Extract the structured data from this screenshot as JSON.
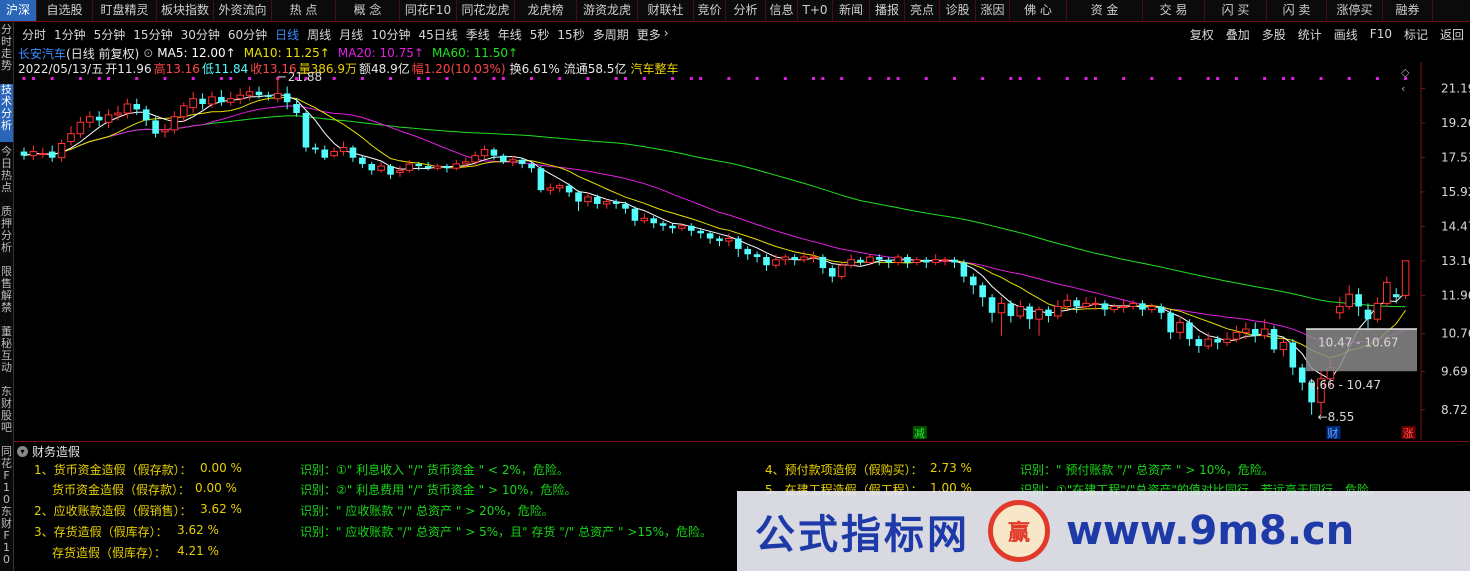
{
  "top_tabs": [
    "沪深",
    "自选股",
    "盯盘精灵",
    "板块指数",
    "外资流向",
    "热 点",
    "概 念",
    "同花F10",
    "同花龙虎",
    "龙虎榜",
    "游资龙虎",
    "财联社",
    "竞价",
    "分析",
    "信息",
    "T+0",
    "新闻",
    "播报",
    "亮点",
    "诊股",
    "涨因",
    "佛 心",
    "资 金",
    "交 易",
    "闪 买",
    "闪 卖",
    "涨停买",
    "融券"
  ],
  "left_tabs": [
    "分时走势",
    "技术分析",
    "今日热点",
    "质押分析",
    "限售解禁",
    "董秘互动",
    "东财股吧",
    "同花F10",
    "东财F10"
  ],
  "periods": [
    "分时",
    "1分钟",
    "5分钟",
    "15分钟",
    "30分钟",
    "60分钟",
    "日线",
    "周线",
    "月线",
    "10分钟",
    "45日线",
    "季线",
    "年线",
    "5秒",
    "15秒",
    "多周期",
    "更多"
  ],
  "active_period": "日线",
  "right_tools": [
    "复权",
    "叠加",
    "多股",
    "统计",
    "画线",
    "F10",
    "标记",
    "返回"
  ],
  "stock": {
    "name": "长安汽车",
    "mode": "(日线 前复权)",
    "ma": [
      {
        "label": "MA5: 12.00",
        "color": "#ffffff"
      },
      {
        "label": "MA10: 11.25",
        "color": "#e8e000"
      },
      {
        "label": "MA20: 10.75",
        "color": "#e020e0"
      },
      {
        "label": "MA60: 11.50",
        "color": "#20e020"
      }
    ],
    "date": "2022/05/13/五",
    "open": "开11.96",
    "high": "高13.16",
    "low": "低11.84",
    "close": "收13.16",
    "vol": "量386.9万",
    "amt": "额48.9亿",
    "chg": "幅1.20(10.03%)",
    "turn": "换6.61%",
    "float": "流通58.5亿",
    "sector": "汽车整车"
  },
  "y_axis": [
    "21.19",
    "19.26",
    "17.51",
    "15.92",
    "14.47",
    "13.16",
    "11.96",
    "10.76",
    "9.69",
    "8.72"
  ],
  "annotations": {
    "high": "21.88",
    "low": "8.55",
    "box1": "10.47 - 10.67",
    "box2": "9.66 - 10.47",
    "jian": "减",
    "cai": "财",
    "zhang": "涨"
  },
  "fin_title": "财务造假",
  "fin_rows": [
    {
      "label": "1、货币资金造假（假存款）：",
      "value": "0.00 %",
      "note": "识别：①\" 利息收入 \"/\" 货币资金 \" < 2%，危险。"
    },
    {
      "label": "货币资金造假（假存款）：",
      "value": "0.00 %",
      "note": "识别：②\" 利息费用 \"/\" 货币资金 \" > 10%，危险。"
    },
    {
      "label": "2、应收账款造假（假销售）：",
      "value": "3.62 %",
      "note": "识别：\" 应收账款 \"/\" 总资产 \" > 20%，危险。"
    },
    {
      "label": "3、存货造假（假库存）：",
      "value": "3.62 %",
      "note": "识别：\" 应收账款 \"/\" 总资产 \" > 5%，且\" 存货 \"/\" 总资产 \" >15%，危险。"
    },
    {
      "label": "存货造假（假库存）：",
      "value": "4.21 %",
      "note": ""
    }
  ],
  "fin_rows_right": [
    {
      "label": "4、预付款项造假（假购买）：",
      "value": "2.73 %",
      "note": "识别：\" 预付账款 \"/\" 总资产 \" > 10%，危险。"
    },
    {
      "label": "5、在建工程造假（假工程）：",
      "value": "1.00 %",
      "note": "识别：①\"在建工程\"/\"总资产\"的值对比同行，若远高于同行，危险。"
    }
  ],
  "watermark": {
    "text1": "公式指标网",
    "text2": "www.9m8.cn"
  },
  "colors": {
    "up": "#ff3232",
    "down": "#54fcfc",
    "ma5": "#ffffff",
    "ma10": "#e8e000",
    "ma20": "#e020e0",
    "ma60": "#20e020"
  },
  "chart_data": {
    "type": "candlestick",
    "ylim": [
      8.2,
      22.3
    ],
    "candles": [
      [
        17.8,
        17.6,
        18.0,
        17.4
      ],
      [
        17.6,
        17.8,
        18.1,
        17.4
      ],
      [
        17.7,
        17.7,
        18.0,
        17.5
      ],
      [
        17.8,
        17.5,
        18.1,
        17.3
      ],
      [
        17.5,
        18.2,
        18.4,
        17.3
      ],
      [
        18.3,
        18.7,
        19.1,
        18.1
      ],
      [
        18.7,
        19.3,
        19.6,
        18.5
      ],
      [
        19.3,
        19.6,
        19.9,
        19.0
      ],
      [
        19.6,
        19.4,
        19.9,
        19.1
      ],
      [
        19.3,
        19.7,
        20.0,
        19.0
      ],
      [
        19.7,
        19.8,
        20.2,
        19.4
      ],
      [
        19.8,
        20.3,
        20.6,
        19.5
      ],
      [
        20.3,
        20.0,
        20.6,
        19.7
      ],
      [
        20.0,
        19.4,
        20.2,
        19.1
      ],
      [
        19.4,
        18.7,
        19.6,
        18.5
      ],
      [
        18.8,
        18.9,
        19.2,
        18.5
      ],
      [
        18.9,
        19.6,
        19.9,
        18.7
      ],
      [
        19.6,
        20.2,
        20.4,
        19.3
      ],
      [
        20.1,
        20.6,
        21.0,
        19.8
      ],
      [
        20.6,
        20.3,
        20.9,
        20.0
      ],
      [
        20.3,
        20.7,
        21.0,
        20.1
      ],
      [
        20.7,
        20.4,
        21.1,
        20.2
      ],
      [
        20.4,
        20.6,
        21.0,
        20.2
      ],
      [
        20.6,
        20.8,
        21.2,
        20.3
      ],
      [
        20.8,
        21.0,
        21.3,
        20.5
      ],
      [
        21.0,
        20.8,
        21.3,
        20.6
      ],
      [
        20.8,
        20.7,
        21.0,
        20.5
      ],
      [
        20.6,
        20.9,
        21.9,
        20.4
      ],
      [
        20.9,
        20.4,
        21.3,
        20.0
      ],
      [
        20.3,
        19.8,
        20.6,
        19.6
      ],
      [
        19.8,
        18.0,
        19.9,
        17.8
      ],
      [
        18.0,
        17.9,
        18.2,
        17.7
      ],
      [
        17.9,
        17.5,
        18.1,
        17.4
      ],
      [
        17.6,
        17.8,
        18.0,
        17.5
      ],
      [
        17.8,
        18.0,
        18.3,
        17.6
      ],
      [
        18.0,
        17.5,
        18.1,
        17.3
      ],
      [
        17.5,
        17.2,
        17.6,
        17.0
      ],
      [
        17.2,
        16.9,
        17.3,
        16.7
      ],
      [
        16.9,
        17.1,
        17.3,
        16.8
      ],
      [
        17.1,
        16.7,
        17.2,
        16.5
      ],
      [
        16.8,
        16.9,
        17.1,
        16.6
      ],
      [
        16.9,
        17.2,
        17.4,
        16.8
      ],
      [
        17.2,
        17.1,
        17.3,
        16.9
      ],
      [
        17.1,
        17.0,
        17.3,
        16.9
      ],
      [
        17.0,
        17.1,
        17.2,
        16.9
      ],
      [
        17.1,
        17.0,
        17.2,
        16.8
      ],
      [
        17.0,
        17.2,
        17.4,
        16.9
      ],
      [
        17.2,
        17.3,
        17.5,
        17.0
      ],
      [
        17.3,
        17.6,
        17.8,
        17.1
      ],
      [
        17.6,
        17.9,
        18.1,
        17.4
      ],
      [
        17.9,
        17.6,
        18.0,
        17.4
      ],
      [
        17.6,
        17.3,
        17.7,
        17.2
      ],
      [
        17.3,
        17.4,
        17.6,
        17.1
      ],
      [
        17.4,
        17.2,
        17.5,
        17.0
      ],
      [
        17.2,
        17.0,
        17.3,
        16.8
      ],
      [
        17.0,
        16.0,
        17.1,
        15.9
      ],
      [
        16.0,
        16.1,
        16.3,
        15.8
      ],
      [
        16.1,
        16.2,
        16.3,
        15.9
      ],
      [
        16.2,
        15.9,
        16.3,
        15.7
      ],
      [
        15.9,
        15.5,
        16.0,
        15.1
      ],
      [
        15.5,
        15.7,
        15.9,
        15.3
      ],
      [
        15.7,
        15.4,
        15.8,
        15.2
      ],
      [
        15.4,
        15.5,
        15.6,
        15.2
      ],
      [
        15.5,
        15.4,
        15.6,
        15.2
      ],
      [
        15.4,
        15.2,
        15.5,
        15.0
      ],
      [
        15.2,
        14.7,
        15.3,
        14.5
      ],
      [
        14.7,
        14.8,
        15.0,
        14.6
      ],
      [
        14.8,
        14.6,
        14.9,
        14.4
      ],
      [
        14.6,
        14.5,
        14.7,
        14.3
      ],
      [
        14.5,
        14.4,
        14.6,
        14.2
      ],
      [
        14.4,
        14.5,
        14.6,
        14.3
      ],
      [
        14.5,
        14.3,
        14.6,
        14.1
      ],
      [
        14.3,
        14.2,
        14.4,
        14.0
      ],
      [
        14.2,
        14.0,
        14.3,
        13.8
      ],
      [
        14.0,
        13.9,
        14.1,
        13.7
      ],
      [
        13.9,
        14.0,
        14.2,
        13.7
      ],
      [
        14.0,
        13.6,
        14.1,
        13.3
      ],
      [
        13.6,
        13.4,
        13.7,
        13.2
      ],
      [
        13.4,
        13.3,
        13.5,
        13.1
      ],
      [
        13.3,
        13.0,
        13.4,
        12.8
      ],
      [
        13.0,
        13.2,
        13.4,
        12.9
      ],
      [
        13.2,
        13.3,
        13.4,
        13.0
      ],
      [
        13.3,
        13.2,
        13.4,
        13.0
      ],
      [
        13.2,
        13.3,
        13.5,
        13.1
      ],
      [
        13.3,
        13.3,
        13.5,
        13.1
      ],
      [
        13.3,
        12.9,
        13.4,
        12.7
      ],
      [
        12.9,
        12.6,
        13.0,
        12.4
      ],
      [
        12.6,
        13.0,
        13.1,
        12.5
      ],
      [
        13.0,
        13.2,
        13.4,
        12.9
      ],
      [
        13.2,
        13.1,
        13.3,
        13.0
      ],
      [
        13.1,
        13.3,
        13.4,
        13.0
      ],
      [
        13.3,
        13.2,
        13.4,
        13.0
      ],
      [
        13.2,
        13.1,
        13.3,
        12.9
      ],
      [
        13.1,
        13.3,
        13.4,
        13.0
      ],
      [
        13.3,
        13.1,
        13.4,
        12.9
      ],
      [
        13.1,
        13.2,
        13.3,
        13.0
      ],
      [
        13.2,
        13.1,
        13.3,
        12.9
      ],
      [
        13.1,
        13.2,
        13.4,
        13.0
      ],
      [
        13.2,
        13.2,
        13.3,
        13.0
      ],
      [
        13.2,
        13.1,
        13.3,
        12.9
      ],
      [
        13.1,
        12.6,
        13.2,
        12.4
      ],
      [
        12.6,
        12.3,
        12.7,
        12.0
      ],
      [
        12.3,
        11.9,
        12.4,
        11.6
      ],
      [
        11.9,
        11.4,
        12.0,
        11.1
      ],
      [
        11.4,
        11.7,
        11.9,
        10.7
      ],
      [
        11.7,
        11.3,
        11.8,
        11.1
      ],
      [
        11.3,
        11.6,
        11.8,
        11.2
      ],
      [
        11.6,
        11.2,
        11.7,
        10.9
      ],
      [
        11.2,
        11.5,
        11.6,
        10.7
      ],
      [
        11.5,
        11.3,
        11.6,
        11.1
      ],
      [
        11.3,
        11.6,
        11.8,
        11.2
      ],
      [
        11.6,
        11.8,
        12.0,
        11.5
      ],
      [
        11.8,
        11.6,
        11.9,
        11.4
      ],
      [
        11.6,
        11.7,
        11.9,
        11.5
      ],
      [
        11.7,
        11.7,
        11.9,
        11.5
      ],
      [
        11.7,
        11.5,
        11.8,
        11.3
      ],
      [
        11.5,
        11.6,
        11.7,
        11.4
      ],
      [
        11.6,
        11.6,
        11.8,
        11.4
      ],
      [
        11.6,
        11.7,
        11.8,
        11.5
      ],
      [
        11.7,
        11.5,
        11.8,
        11.3
      ],
      [
        11.5,
        11.6,
        11.7,
        11.4
      ],
      [
        11.6,
        11.4,
        11.7,
        11.2
      ],
      [
        11.4,
        10.8,
        11.5,
        10.6
      ],
      [
        10.8,
        11.1,
        11.3,
        10.6
      ],
      [
        11.1,
        10.6,
        11.2,
        10.4
      ],
      [
        10.6,
        10.4,
        10.7,
        10.2
      ],
      [
        10.4,
        10.6,
        10.8,
        10.3
      ],
      [
        10.6,
        10.5,
        10.7,
        10.3
      ],
      [
        10.5,
        10.6,
        10.8,
        10.4
      ],
      [
        10.6,
        10.8,
        11.0,
        10.5
      ],
      [
        10.8,
        10.9,
        11.1,
        10.6
      ],
      [
        10.9,
        10.7,
        11.1,
        10.5
      ],
      [
        10.7,
        10.9,
        11.2,
        10.6
      ],
      [
        10.9,
        10.3,
        11.0,
        10.2
      ],
      [
        10.3,
        10.5,
        10.6,
        10.1
      ],
      [
        10.5,
        9.8,
        10.6,
        9.6
      ],
      [
        9.8,
        9.4,
        9.9,
        9.2
      ],
      [
        9.4,
        8.9,
        9.5,
        8.6
      ],
      [
        8.9,
        9.5,
        9.7,
        8.6
      ],
      [
        9.5,
        9.8,
        10.1,
        9.3
      ],
      [
        11.4,
        11.6,
        11.9,
        11.2
      ],
      [
        11.6,
        12.0,
        12.3,
        11.5
      ],
      [
        12.0,
        11.6,
        12.2,
        11.3
      ],
      [
        11.5,
        11.2,
        11.7,
        10.9
      ],
      [
        11.2,
        11.7,
        11.9,
        11.1
      ],
      [
        11.7,
        12.4,
        12.6,
        11.6
      ],
      [
        12.0,
        11.9,
        12.2,
        11.7
      ],
      [
        11.96,
        13.16,
        13.16,
        11.84
      ]
    ],
    "ma5_color": "#ffffff",
    "ma10_color": "#e8e000",
    "ma20_color": "#e020e0",
    "ma60_color": "#20e020"
  }
}
